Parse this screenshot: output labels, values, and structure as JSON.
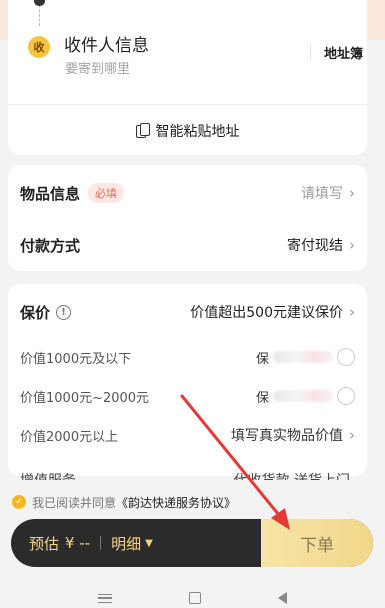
{
  "recipient": {
    "badge": "收",
    "title": "收件人信息",
    "subtitle": "要寄到哪里",
    "address_book": "地址簿",
    "smart_paste": "智能粘贴地址"
  },
  "items_card": {
    "goods": {
      "label": "物品信息",
      "badge": "必填",
      "value": "请填写"
    },
    "payment": {
      "label": "付款方式",
      "value": "寄付现结"
    }
  },
  "insurance": {
    "label": "保价",
    "hint": "价值超出500元建议保价",
    "options": [
      {
        "label": "价值1000元及以下",
        "value": "保"
      },
      {
        "label": "价值1000元~2000元",
        "value": "保"
      },
      {
        "label": "价值2000元以上",
        "value": "填写真实物品价值"
      }
    ],
    "cut_row_left": "增值服务",
    "cut_row_right": "代收货款  送货上门"
  },
  "agreement": {
    "prefix": "我已阅读并同意",
    "link": "《韵达快递服务协议》"
  },
  "order_bar": {
    "estimate_label": "预估",
    "estimate_value": "¥ --",
    "detail_label": "明细",
    "submit_label": "下单"
  },
  "colors": {
    "accent_yellow": "#f2b81d",
    "arrow_red": "#e53935",
    "badge_red": "#e06a5c",
    "bar_dark": "#2b2b2b"
  }
}
